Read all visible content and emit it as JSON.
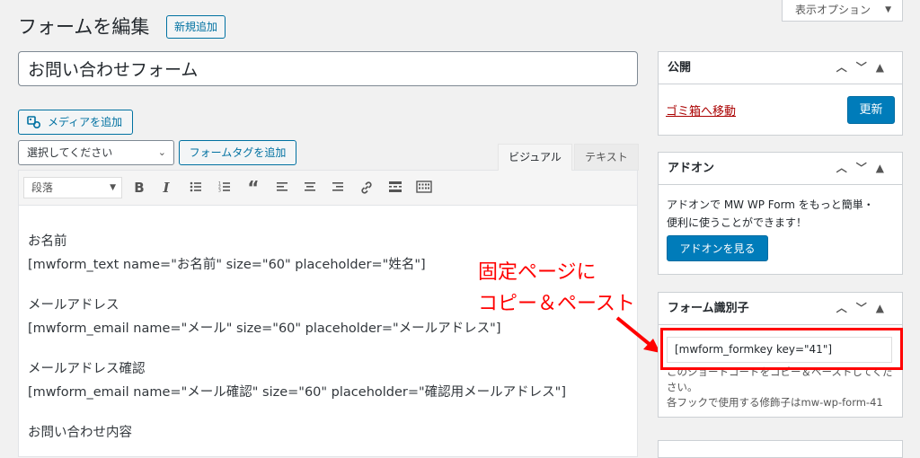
{
  "header": {
    "title": "フォームを編集",
    "add_new_label": "新規追加",
    "screen_options_label": "表示オプション"
  },
  "post_title": "お問い合わせフォーム",
  "editor": {
    "media_button_label": "メディアを追加",
    "select_value": "選択してください",
    "form_tag_button_label": "フォームタグを追加",
    "tab_visual": "ビジュアル",
    "tab_text": "テキスト",
    "format_value": "段落",
    "toolbar_icons": [
      "bold-icon",
      "italic-icon",
      "bullet-list-icon",
      "numbered-list-icon",
      "blockquote-icon",
      "align-left-icon",
      "align-center-icon",
      "align-right-icon",
      "link-icon",
      "read-more-icon",
      "toolbar-toggle-icon"
    ],
    "lines": [
      "お名前",
      "[mwform_text name=\"お名前\" size=\"60\" placeholder=\"姓名\"]",
      "メールアドレス",
      "[mwform_email name=\"メール\" size=\"60\" placeholder=\"メールアドレス\"]",
      "メールアドレス確認",
      "[mwform_email name=\"メール確認\" size=\"60\" placeholder=\"確認用メールアドレス\"]",
      "お問い合わせ内容"
    ]
  },
  "annotation": {
    "line1": "固定ページに",
    "line2": "コピー＆ペースト",
    "color": "#ff0000"
  },
  "sidebar": {
    "publish": {
      "title": "公開",
      "trash_label": "ゴミ箱へ移動",
      "update_label": "更新"
    },
    "addon": {
      "title": "アドオン",
      "desc_line1": "アドオンで MW WP Form をもっと簡単・",
      "desc_line2": "便利に使うことができます！",
      "button_label": "アドオンを見る"
    },
    "form_id": {
      "title": "フォーム識別子",
      "key_value": "[mwform_formkey key=\"41\"]",
      "note_line1": "このショートコードをコピー＆ペーストしてくだ",
      "note_line2": "さい。",
      "note_line3": "各フックで使用する修飾子はmw-wp-form-41"
    }
  },
  "colors": {
    "accent": "#007cba",
    "link": "#0071a1",
    "danger": "#a00"
  }
}
